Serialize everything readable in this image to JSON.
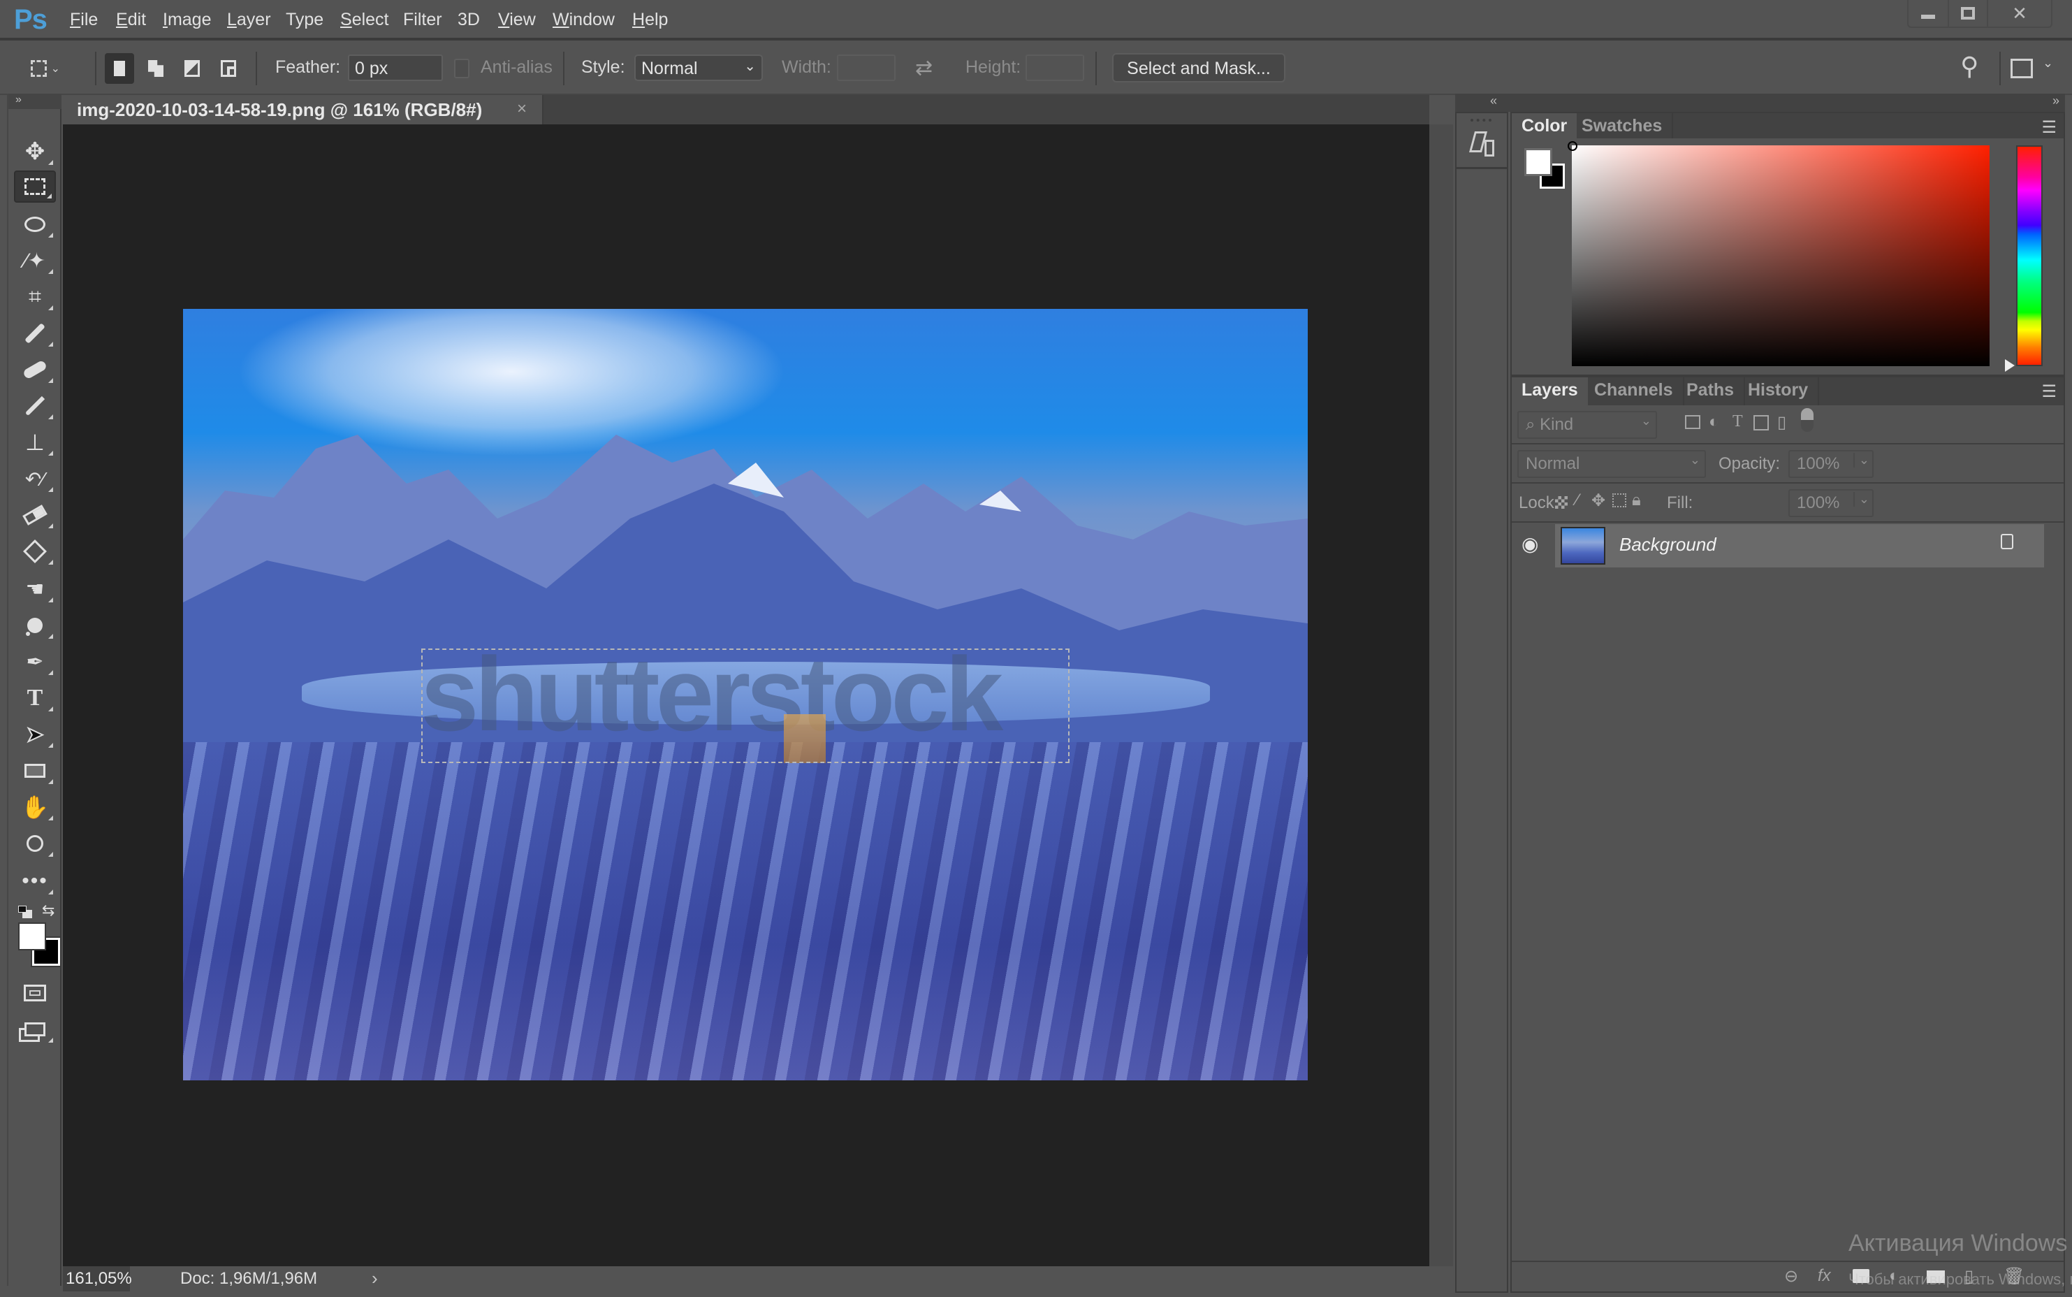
{
  "app": {
    "logo": "Ps",
    "title_tab": "img-2020-10-03-14-58-19.png @ 161% (RGB/8#)",
    "tab_close": "×"
  },
  "menu": [
    {
      "label": "File",
      "u": "F",
      "rest": "ile"
    },
    {
      "label": "Edit",
      "u": "E",
      "rest": "dit"
    },
    {
      "label": "Image",
      "u": "I",
      "rest": "mage"
    },
    {
      "label": "Layer",
      "u": "L",
      "rest": "ayer"
    },
    {
      "label": "Type",
      "u": "",
      "rest": "Type"
    },
    {
      "label": "Select",
      "u": "S",
      "rest": "elect"
    },
    {
      "label": "Filter",
      "u": "",
      "rest": "Filter"
    },
    {
      "label": "3D",
      "u": "",
      "rest": "3D"
    },
    {
      "label": "View",
      "u": "V",
      "rest": "iew"
    },
    {
      "label": "Window",
      "u": "W",
      "rest": "indow"
    },
    {
      "label": "Help",
      "u": "H",
      "rest": "elp"
    }
  ],
  "window_controls": {
    "minimize": "—",
    "maximize": "☐",
    "close": "✕"
  },
  "options": {
    "feather_label": "Feather:",
    "feather_value": "0 px",
    "antialias_label": "Anti-alias",
    "antialias_checked": false,
    "style_label": "Style:",
    "style_value": "Normal",
    "width_label": "Width:",
    "width_value": "",
    "height_label": "Height:",
    "height_value": "",
    "select_mask_label": "Select and Mask..."
  },
  "toolbar": {
    "collapse": "»",
    "tools": [
      "move",
      "rectangular-marquee",
      "lasso",
      "magic-wand",
      "crop",
      "eyedropper",
      "healing-brush",
      "brush",
      "clone-stamp",
      "history-brush",
      "eraser",
      "paint-bucket",
      "smudge",
      "dodge",
      "pen",
      "type",
      "path-selection",
      "rectangle",
      "hand",
      "zoom",
      "edit-toolbar"
    ],
    "active_tool": "rectangular-marquee"
  },
  "canvas": {
    "watermark_text": "shutterstock"
  },
  "status": {
    "zoom": "161,05%",
    "doc": "Doc: 1,96M/1,96M",
    "arrow": "›"
  },
  "dock": {
    "collapse_left": "«",
    "collapse_right": "»"
  },
  "color_panel": {
    "tabs": [
      "Color",
      "Swatches"
    ],
    "active_tab": "Color",
    "foreground": "#ffffff",
    "background": "#000000",
    "hue": "#ff2000"
  },
  "layers_panel": {
    "tabs": [
      "Layers",
      "Channels",
      "Paths",
      "History"
    ],
    "active_tab": "Layers",
    "filter_kind": "Kind",
    "blend_mode": "Normal",
    "opacity_label": "Opacity:",
    "opacity_value": "100%",
    "lock_label": "Lock:",
    "fill_label": "Fill:",
    "fill_value": "100%",
    "layers": [
      {
        "name": "Background",
        "visible": true,
        "locked": true
      }
    ]
  },
  "os_overlay": {
    "line1": "Активация Windows",
    "line2": "Чтобы активировать Windows, п"
  }
}
